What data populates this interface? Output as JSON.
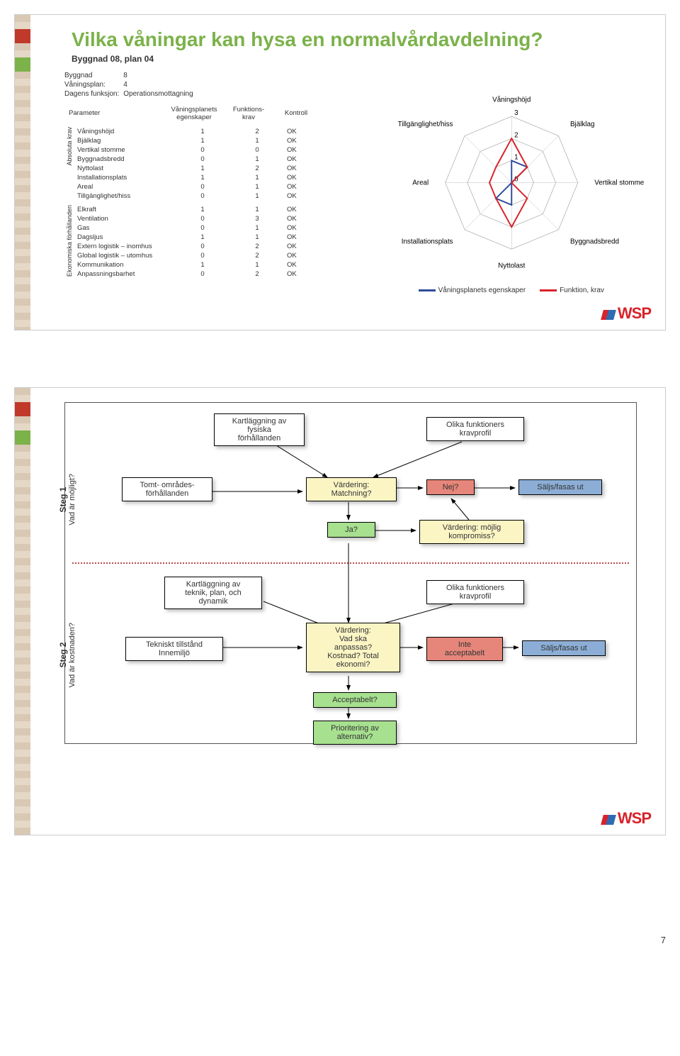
{
  "slide1": {
    "title": "Vilka våningar kan hysa en normalvårdavdelning?",
    "subtitle": "Byggnad 08, plan 04",
    "meta": {
      "rows": [
        {
          "k": "Byggnad",
          "v": "8"
        },
        {
          "k": "Våningsplan:",
          "v": "4"
        },
        {
          "k": "Dagens funksjon:",
          "v": "Operationsmottagning"
        }
      ]
    },
    "headers": {
      "param": "Parameter",
      "prop": "Våningsplanets\negenskaper",
      "req": "Funktions-\nkrav",
      "ctrl": "Kontroll"
    },
    "group1_label": "Absoluta krav",
    "group1": [
      {
        "p": "Våningshöjd",
        "a": "1",
        "b": "2",
        "c": "OK"
      },
      {
        "p": "Bjälklag",
        "a": "1",
        "b": "1",
        "c": "OK"
      },
      {
        "p": "Vertikal stomme",
        "a": "0",
        "b": "0",
        "c": "OK"
      },
      {
        "p": "Byggnadsbredd",
        "a": "0",
        "b": "1",
        "c": "OK"
      },
      {
        "p": "Nyttolast",
        "a": "1",
        "b": "2",
        "c": "OK"
      },
      {
        "p": "Installationsplats",
        "a": "1",
        "b": "1",
        "c": "OK"
      },
      {
        "p": "Areal",
        "a": "0",
        "b": "1",
        "c": "OK"
      },
      {
        "p": "Tillgänglighet/hiss",
        "a": "0",
        "b": "1",
        "c": "OK"
      }
    ],
    "group2_label": "Ekonomiska\nförhållanden",
    "group2": [
      {
        "p": "Elkraft",
        "a": "1",
        "b": "1",
        "c": "OK"
      },
      {
        "p": "Ventilation",
        "a": "0",
        "b": "3",
        "c": "OK"
      },
      {
        "p": "Gas",
        "a": "0",
        "b": "1",
        "c": "OK"
      },
      {
        "p": "Dagsljus",
        "a": "1",
        "b": "1",
        "c": "OK"
      },
      {
        "p": "Extern logistik – inomhus",
        "a": "0",
        "b": "2",
        "c": "OK"
      },
      {
        "p": "Global logistik – utomhus",
        "a": "0",
        "b": "2",
        "c": "OK"
      },
      {
        "p": "Kommunikation",
        "a": "1",
        "b": "1",
        "c": "OK"
      },
      {
        "p": "Anpassningsbarhet",
        "a": "0",
        "b": "2",
        "c": "OK"
      }
    ],
    "radar_labels": [
      "Våningshöjd",
      "Bjälklag",
      "Vertikal stomme",
      "Byggnadsbredd",
      "Nyttolast",
      "Installationsplats",
      "Areal",
      "Tillgänglighet/hiss"
    ],
    "legend": {
      "blue": "Våningsplanets egenskaper",
      "red": "Funktion, krav"
    },
    "logo": "WSP"
  },
  "chart_data": {
    "type": "radar",
    "title": "",
    "categories": [
      "Våningshöjd",
      "Bjälklag",
      "Vertikal stomme",
      "Byggnadsbredd",
      "Nyttolast",
      "Installationsplats",
      "Areal",
      "Tillgänglighet/hiss"
    ],
    "rlim": [
      0,
      3
    ],
    "series": [
      {
        "name": "Våningsplanets egenskaper",
        "color": "#2e4b9b",
        "values": [
          1,
          1,
          0,
          0,
          1,
          1,
          0,
          0
        ]
      },
      {
        "name": "Funktion, krav",
        "color": "#d8232a",
        "values": [
          2,
          1,
          0,
          1,
          2,
          1,
          1,
          1
        ]
      }
    ]
  },
  "slide2": {
    "step1": {
      "line1": "Steg 1",
      "line2": "Vad är möjligt?"
    },
    "step2": {
      "line1": "Steg 2",
      "line2": "Vad är kostnaden?"
    },
    "boxes": {
      "b1": "Kartläggning av\nfysiska\nförhållanden",
      "b2": "Olika funktioners\nkravprofil",
      "b3": "Tomt- områdes-\nförhållanden",
      "b4": "Värdering:\nMatchning?",
      "b5": "Nej?",
      "b6": "Säljs/fasas ut",
      "b7": "Ja?",
      "b8": "Värdering: möjlig\nkompromiss?",
      "b9": "Kartläggning av\nteknik, plan, och\ndynamik",
      "b10": "Olika funktioners\nkravprofil",
      "b11": "Tekniskt tillstånd\nInnemiljö",
      "b12": "Värdering:\nVad ska\nanpassas?\nKostnad? Total\nekonomi?",
      "b13": "Inte\nacceptabelt",
      "b14": "Säljs/fasas ut",
      "b15": "Acceptabelt?",
      "b16": "Prioritering av\nalternativ?"
    },
    "logo": "WSP",
    "page": "7"
  }
}
